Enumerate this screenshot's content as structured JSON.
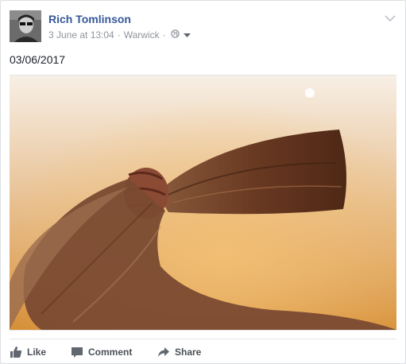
{
  "post": {
    "author": "Rich Tomlinson",
    "timestamp": "3 June at 13:04",
    "location": "Warwick",
    "separator": "·",
    "audience_icon": "globe-icon",
    "text": "03/06/2017",
    "photo_icon": "hair-ponytail-photo"
  },
  "actions": {
    "like": "Like",
    "comment": "Comment",
    "share": "Share"
  },
  "colors": {
    "author_link": "#365899",
    "meta": "#90949c",
    "action_text": "#4b4f56"
  }
}
